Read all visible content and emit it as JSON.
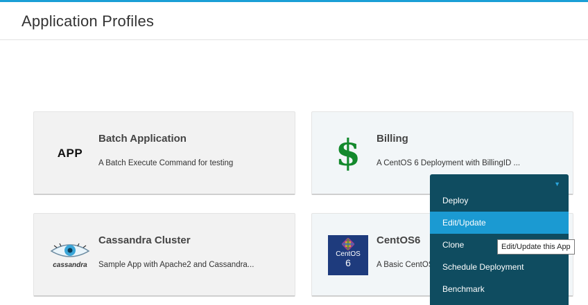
{
  "header": {
    "title": "Application Profiles"
  },
  "cards": [
    {
      "logo": "APP",
      "title": "Batch Application",
      "description": "A Batch Execute Command for testing"
    },
    {
      "logo": "$",
      "title": "Billing",
      "description": "A CentOS 6 Deployment with BillingID ..."
    },
    {
      "logo": "cassandra",
      "title": "Cassandra Cluster",
      "description": "Sample App with Apache2 and Cassandra..."
    },
    {
      "logo_word": "CentOS",
      "logo_version": "6",
      "title": "CentOS6",
      "description": "A Basic CentOS"
    }
  ],
  "menu": {
    "items": [
      {
        "label": "Deploy"
      },
      {
        "label": "Edit/Update"
      },
      {
        "label": "Clone"
      },
      {
        "label": "Schedule Deployment"
      },
      {
        "label": "Benchmark"
      }
    ]
  },
  "tooltip": {
    "text": "Edit/Update this App"
  },
  "colors": {
    "accent": "#1a9fd6",
    "menu_bg": "#0f4c60",
    "menu_active": "#1b9ad2",
    "billing_green": "#13892c",
    "centos_blue": "#1e3b7d"
  }
}
